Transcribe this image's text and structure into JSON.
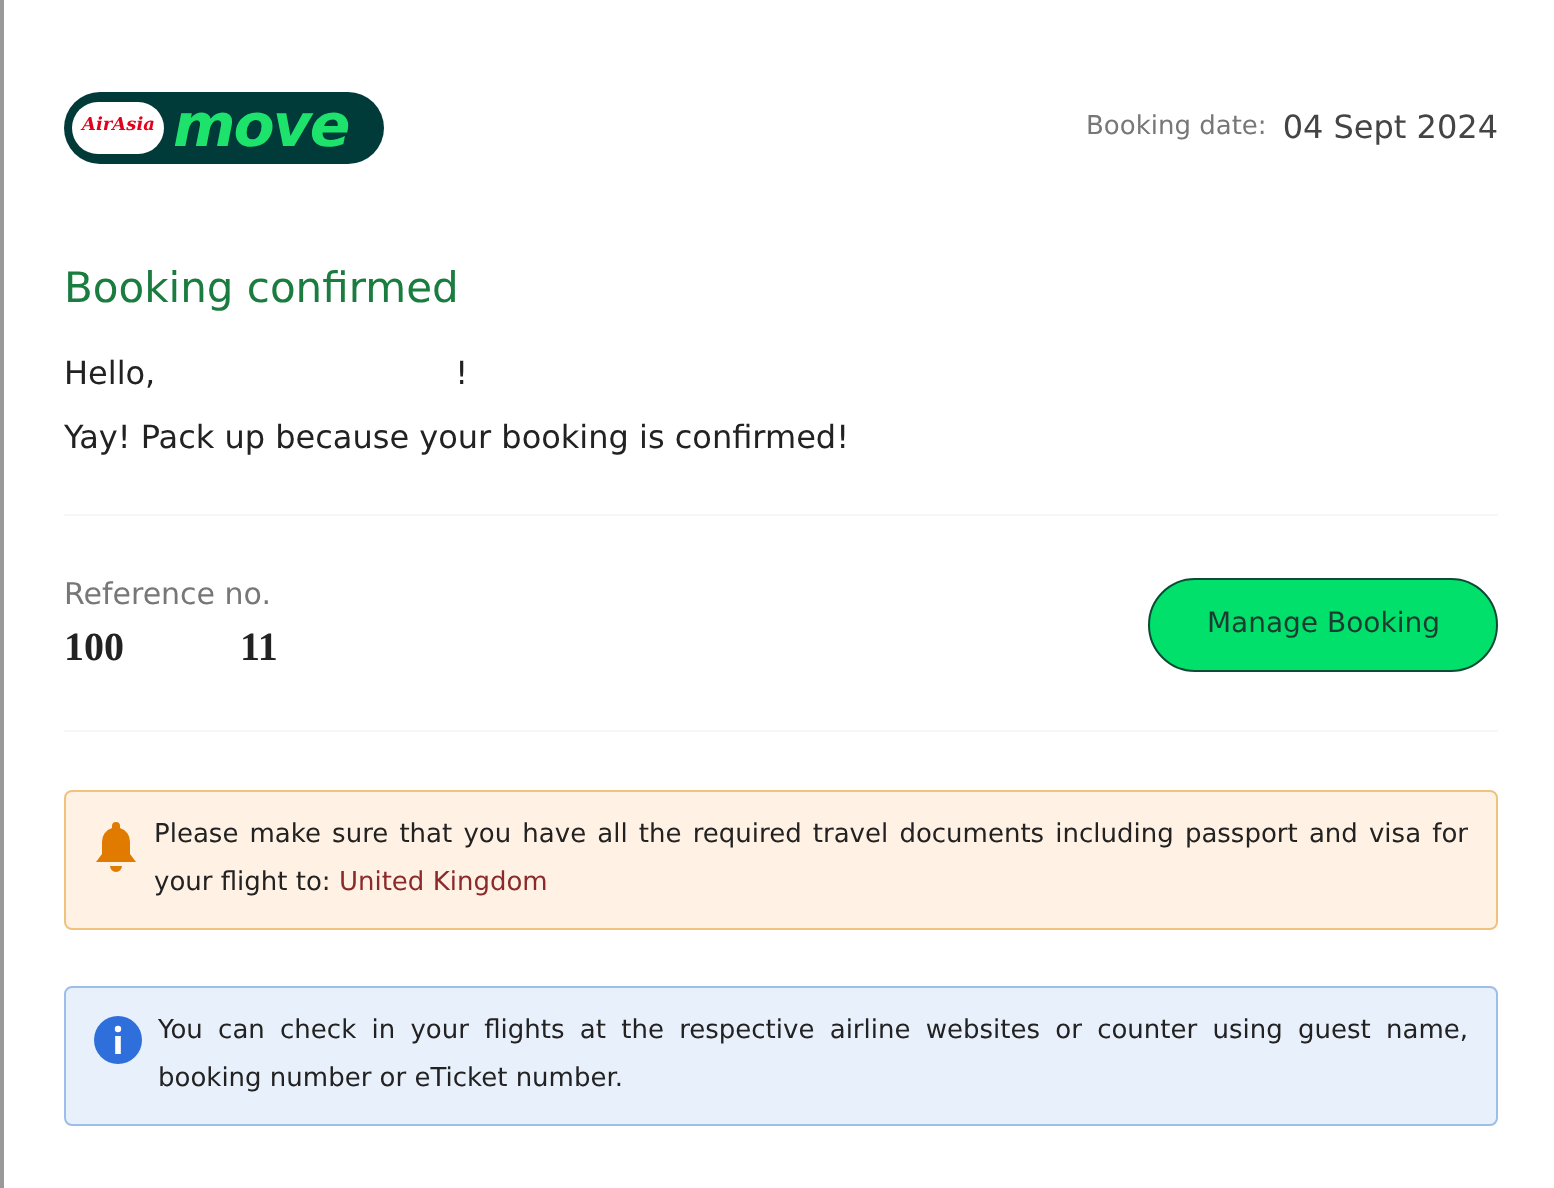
{
  "logo": {
    "badge": "AirAsia",
    "word": "move"
  },
  "booking_date": {
    "label": "Booking date:",
    "value": "04 Sept 2024"
  },
  "heading": "Booking confirmed",
  "greeting": {
    "hello": "Hello,",
    "end": "!"
  },
  "message": "Yay! Pack up because your booking is confirmed!",
  "reference": {
    "label": "Reference no.",
    "start": "100",
    "end": "11"
  },
  "manage_button": "Manage Booking",
  "alerts": [
    {
      "kind": "warning",
      "text": "Please make sure that you have all the required travel documents including passport and visa for your flight to:",
      "destination": "United Kingdom"
    },
    {
      "kind": "info",
      "text": "You can check in your flights at the respective airline websites or counter using guest name, booking number or eTicket number."
    }
  ]
}
